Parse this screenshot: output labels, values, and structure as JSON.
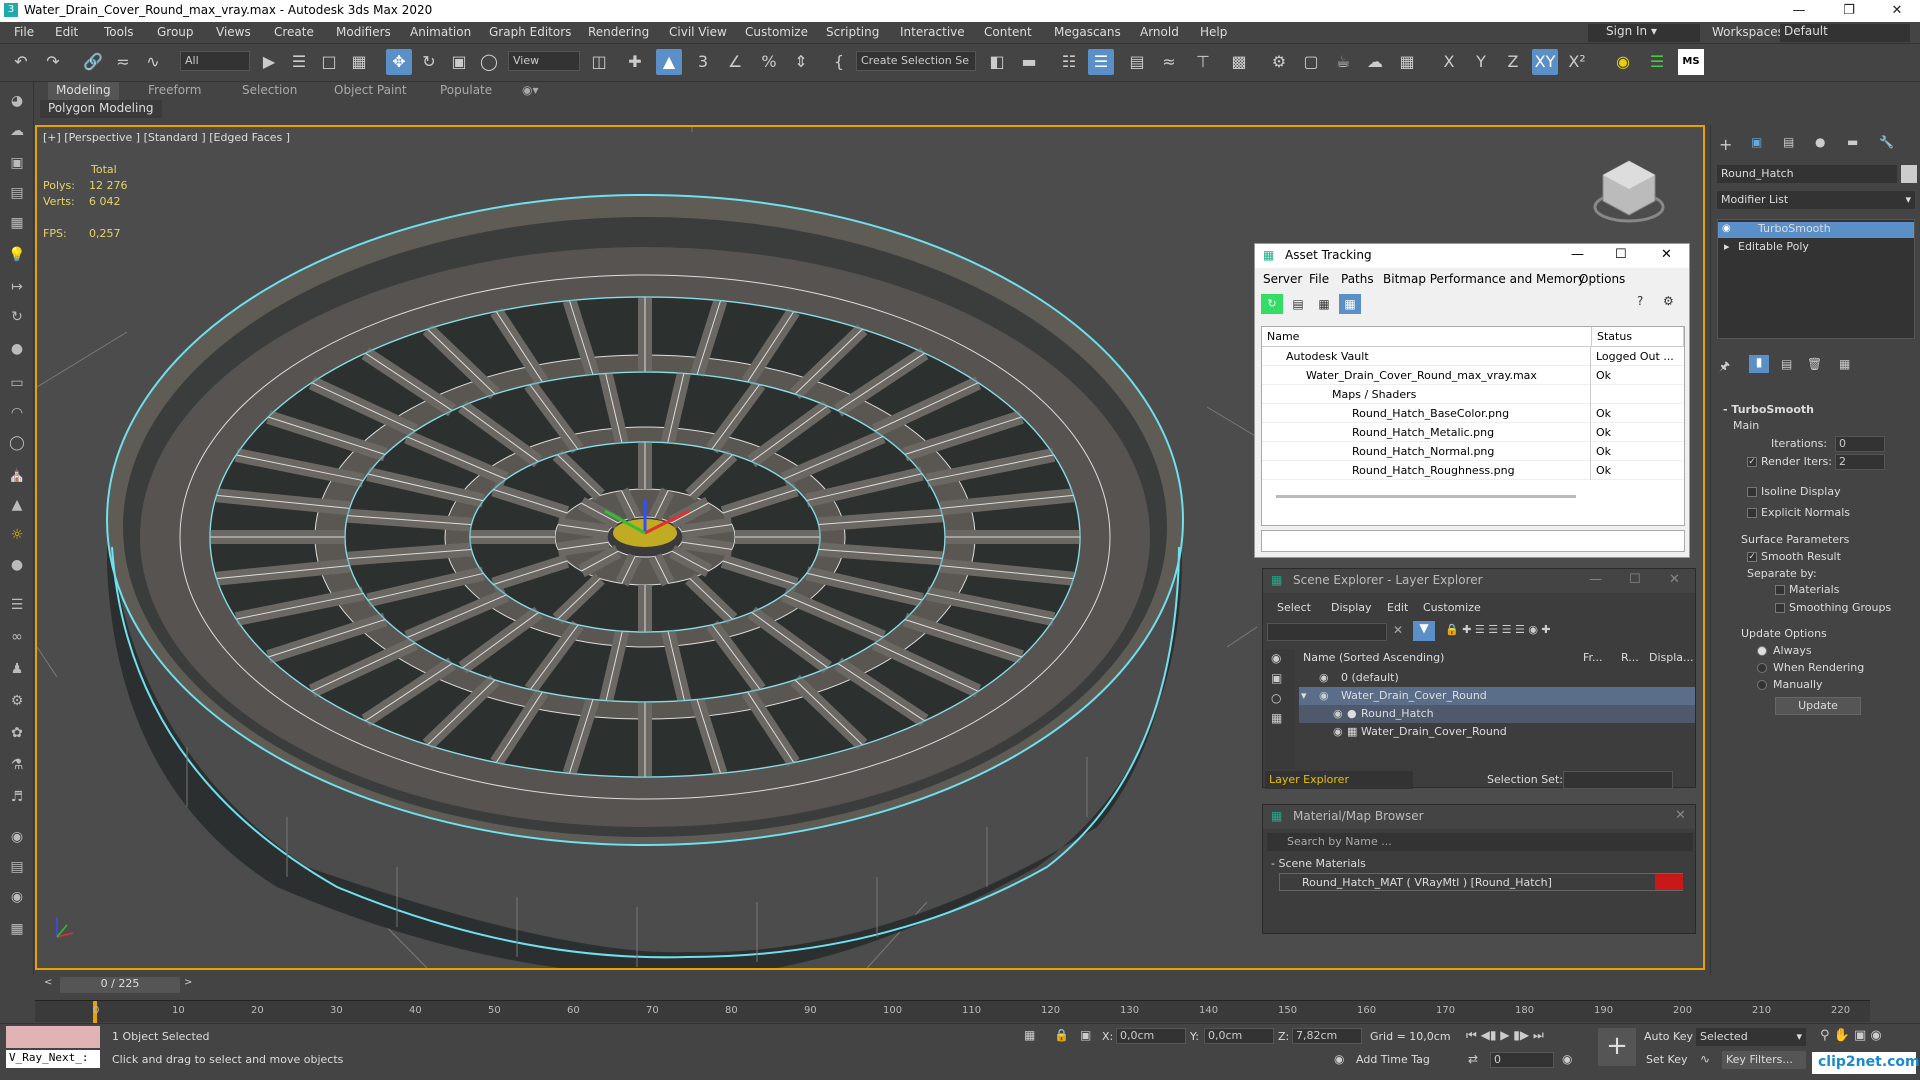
{
  "title": "Water_Drain_Cover_Round_max_vray.max - Autodesk 3ds Max 2020",
  "menu": [
    "File",
    "Edit",
    "Tools",
    "Group",
    "Views",
    "Create",
    "Modifiers",
    "Animation",
    "Graph Editors",
    "Rendering",
    "Civil View",
    "Customize",
    "Scripting",
    "Interactive",
    "Content",
    "Megascans",
    "Arnold",
    "Help"
  ],
  "signin": "Sign In",
  "workspaces_label": "Workspaces:",
  "workspace": "Default",
  "toolbar": {
    "filter": "All",
    "view": "View",
    "selection_set": "Create Selection Se",
    "axes": [
      "X",
      "Y",
      "Z",
      "XY"
    ]
  },
  "ribbon": {
    "tabs": [
      "Modeling",
      "Freeform",
      "Selection",
      "Object Paint",
      "Populate"
    ],
    "sub": "Polygon Modeling"
  },
  "viewport": {
    "label": "[+] [Perspective ] [Standard ] [Edged Faces ]",
    "stats_total": "Total",
    "polys_label": "Polys:",
    "polys": "12 276",
    "verts_label": "Verts:",
    "verts": "6 042",
    "fps_label": "FPS:",
    "fps": "0,257"
  },
  "asset_tracking": {
    "title": "Asset Tracking",
    "menu": [
      "Server",
      "File",
      "Paths",
      "Bitmap Performance and Memory",
      "Options"
    ],
    "col_name": "Name",
    "col_status": "Status",
    "rows": [
      {
        "name": "Autodesk Vault",
        "status": "Logged Out ..."
      },
      {
        "name": "Water_Drain_Cover_Round_max_vray.max",
        "status": "Ok"
      },
      {
        "name": "Maps / Shaders",
        "status": ""
      },
      {
        "name": "Round_Hatch_BaseColor.png",
        "status": "Ok"
      },
      {
        "name": "Round_Hatch_Metalic.png",
        "status": "Ok"
      },
      {
        "name": "Round_Hatch_Normal.png",
        "status": "Ok"
      },
      {
        "name": "Round_Hatch_Roughness.png",
        "status": "Ok"
      }
    ]
  },
  "scene_explorer": {
    "title": "Scene Explorer - Layer Explorer",
    "menu": [
      "Select",
      "Display",
      "Edit",
      "Customize"
    ],
    "col_name": "Name (Sorted Ascending)",
    "col_fr": "Fr...",
    "col_r": "R...",
    "col_disp": "Displa...",
    "rows": [
      "0 (default)",
      "Water_Drain_Cover_Round",
      "Round_Hatch",
      "Water_Drain_Cover_Round"
    ],
    "footer_layer": "Layer Explorer",
    "selection_set": "Selection Set:"
  },
  "material_browser": {
    "title": "Material/Map Browser",
    "search": "Search by Name ...",
    "group": "- Scene Materials",
    "item": "Round_Hatch_MAT  ( VRayMtl )  [Round_Hatch]"
  },
  "command_panel": {
    "object_name": "Round_Hatch",
    "modifier_list": "Modifier List",
    "stack": [
      "TurboSmooth",
      "Editable Poly"
    ],
    "rollout": "TurboSmooth",
    "main": "Main",
    "iterations_label": "Iterations:",
    "iterations": "0",
    "render_iters_label": "Render Iters:",
    "render_iters": "2",
    "isoline": "Isoline Display",
    "explicit": "Explicit Normals",
    "surface_params": "Surface Parameters",
    "smooth_result": "Smooth Result",
    "separate_by": "Separate by:",
    "materials": "Materials",
    "smoothing_groups": "Smoothing Groups",
    "update_options": "Update Options",
    "always": "Always",
    "when_rendering": "When Rendering",
    "manually": "Manually",
    "update": "Update"
  },
  "timeline": {
    "frame": "0 / 225",
    "ticks": [
      "0",
      "10",
      "20",
      "30",
      "40",
      "50",
      "60",
      "70",
      "80",
      "90",
      "100",
      "110",
      "120",
      "130",
      "140",
      "150",
      "160",
      "170",
      "180",
      "190",
      "200",
      "210",
      "220"
    ]
  },
  "status": {
    "script": "V_Ray_Next_:",
    "selected": "1 Object Selected",
    "hint": "Click and drag to select and move objects",
    "x_label": "X:",
    "x": "0,0cm",
    "y_label": "Y:",
    "y": "0,0cm",
    "z_label": "Z:",
    "z": "7,82cm",
    "grid": "Grid = 10,0cm",
    "add_time_tag": "Add Time Tag",
    "auto_key": "Auto Key",
    "set_key": "Set Key",
    "selected_dd": "Selected",
    "key_filters": "Key Filters...",
    "frame_field": "0",
    "watermark": "clip2net.com"
  }
}
